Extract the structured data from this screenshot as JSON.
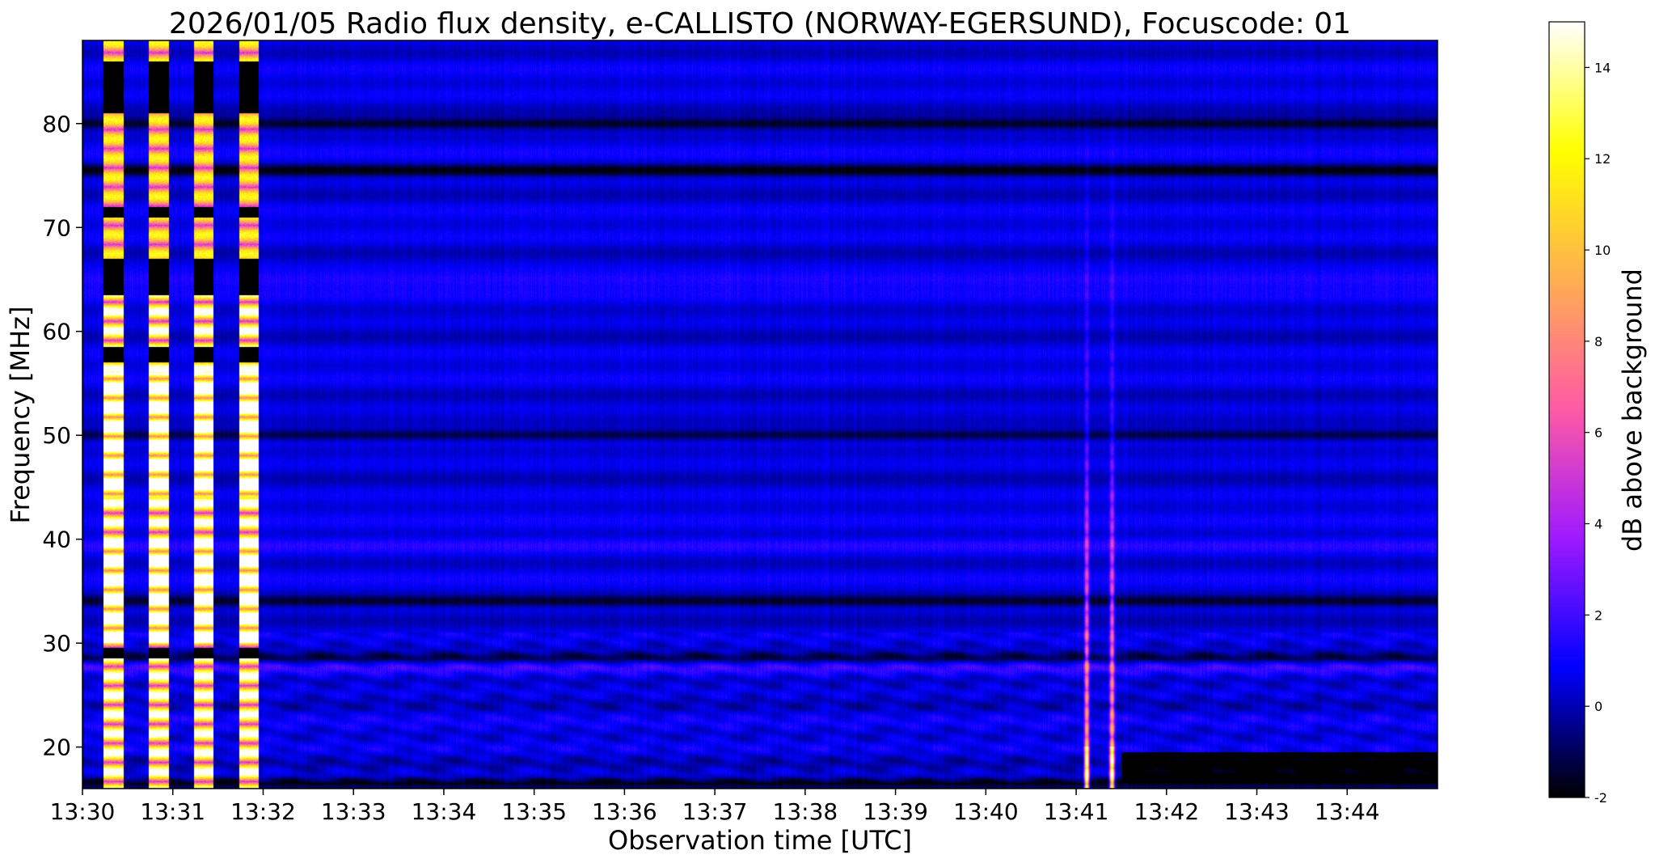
{
  "chart_data": {
    "type": "heatmap",
    "title": "2026/01/05  Radio flux density, e-CALLISTO (NORWAY-EGERSUND), Focuscode: 01",
    "xlabel": "Observation time [UTC]",
    "ylabel": "Frequency [MHz]",
    "x_ticks": [
      "13:30",
      "13:31",
      "13:32",
      "13:33",
      "13:34",
      "13:35",
      "13:36",
      "13:37",
      "13:38",
      "13:39",
      "13:40",
      "13:41",
      "13:42",
      "13:43",
      "13:44"
    ],
    "x_range_minutes": [
      0,
      15
    ],
    "y_ticks": [
      20,
      30,
      40,
      50,
      60,
      70,
      80
    ],
    "ylim": [
      16,
      88
    ],
    "colorbar": {
      "label": "dB above background",
      "ticks": [
        -2,
        0,
        2,
        4,
        6,
        8,
        10,
        12,
        14
      ],
      "range": [
        -2,
        15
      ],
      "colormap": "gnuplot2",
      "stops": [
        "#000000",
        "#0000ff",
        "#9f19ff",
        "#ff5aa6",
        "#ffae51",
        "#ffff00",
        "#ffffff"
      ]
    },
    "features": {
      "background_db": 0.5,
      "calibration_pulses_minutes": [
        [
          0.23,
          0.45
        ],
        [
          0.73,
          0.95
        ],
        [
          1.23,
          1.45
        ],
        [
          1.73,
          1.95
        ]
      ],
      "burst_minutes": [
        11.02,
        11.52
      ],
      "burst_freq_range_mhz": [
        16,
        85
      ],
      "dark_bands_mhz": [
        16.5,
        28.5,
        34,
        50,
        75.5,
        80
      ],
      "bright_bands_mhz": [
        27.5,
        39.5,
        65
      ]
    }
  }
}
